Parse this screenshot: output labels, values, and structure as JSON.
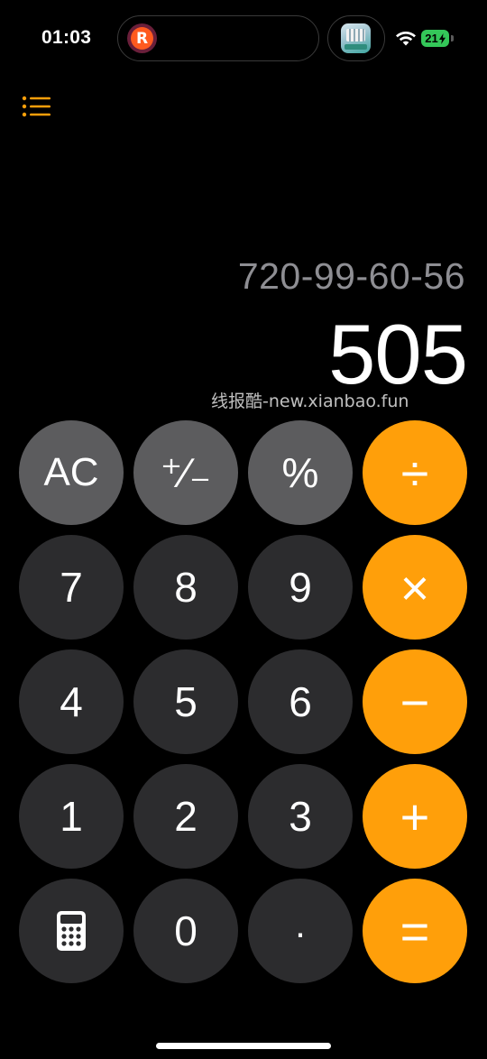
{
  "status_bar": {
    "time": "01:03",
    "island_app_letter": "R",
    "battery": "21",
    "icons": [
      "wifi-icon",
      "battery-icon",
      "charging-bolt-icon"
    ]
  },
  "display": {
    "expression": "720-99-60-56",
    "result": "505",
    "watermark": "线报酷-new.xianbao.fun"
  },
  "keys": {
    "ac": "AC",
    "plus_minus": "⁺∕₋",
    "percent": "%",
    "divide": "÷",
    "seven": "7",
    "eight": "8",
    "nine": "9",
    "multiply": "×",
    "four": "4",
    "five": "5",
    "six": "6",
    "minus": "−",
    "one": "1",
    "two": "2",
    "three": "3",
    "plus": "+",
    "zero": "0",
    "decimal": ".",
    "equals": "="
  },
  "colors": {
    "background": "#000000",
    "function_key": "#5c5c5e",
    "number_key": "#2c2c2e",
    "operator_key": "#ff9f0a",
    "accent_icon": "#ff9f0a",
    "expression_text": "#8e8e93",
    "battery": "#34c759"
  }
}
